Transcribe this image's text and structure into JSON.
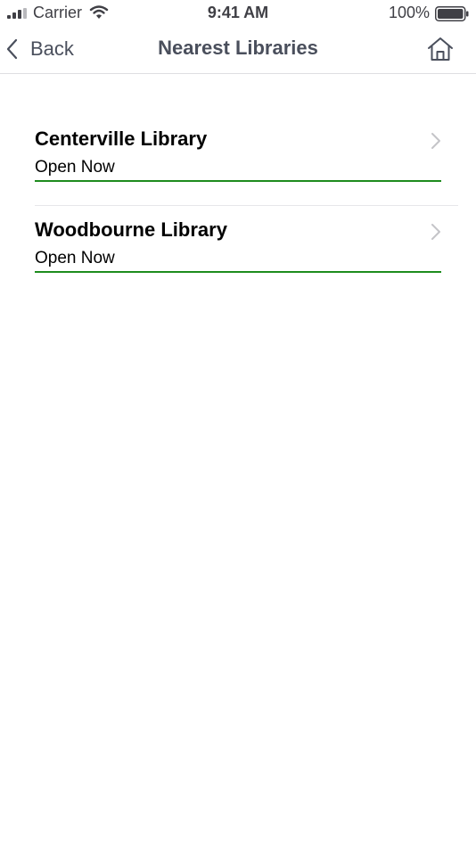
{
  "status_bar": {
    "carrier": "Carrier",
    "time": "9:41 AM",
    "battery": "100%",
    "icons": [
      "signal-icon",
      "wifi-icon",
      "battery-icon"
    ]
  },
  "nav": {
    "back_label": "Back",
    "title": "Nearest Libraries",
    "icons": [
      "chevron-left-icon",
      "home-icon"
    ]
  },
  "libraries": [
    {
      "name": "Centerville Library",
      "status": "Open Now"
    },
    {
      "name": "Woodbourne Library",
      "status": "Open Now"
    }
  ],
  "colors": {
    "open_status": "#1e8c1e",
    "nav_text": "#4a4f5c",
    "chevron": "#c4c4c8"
  }
}
